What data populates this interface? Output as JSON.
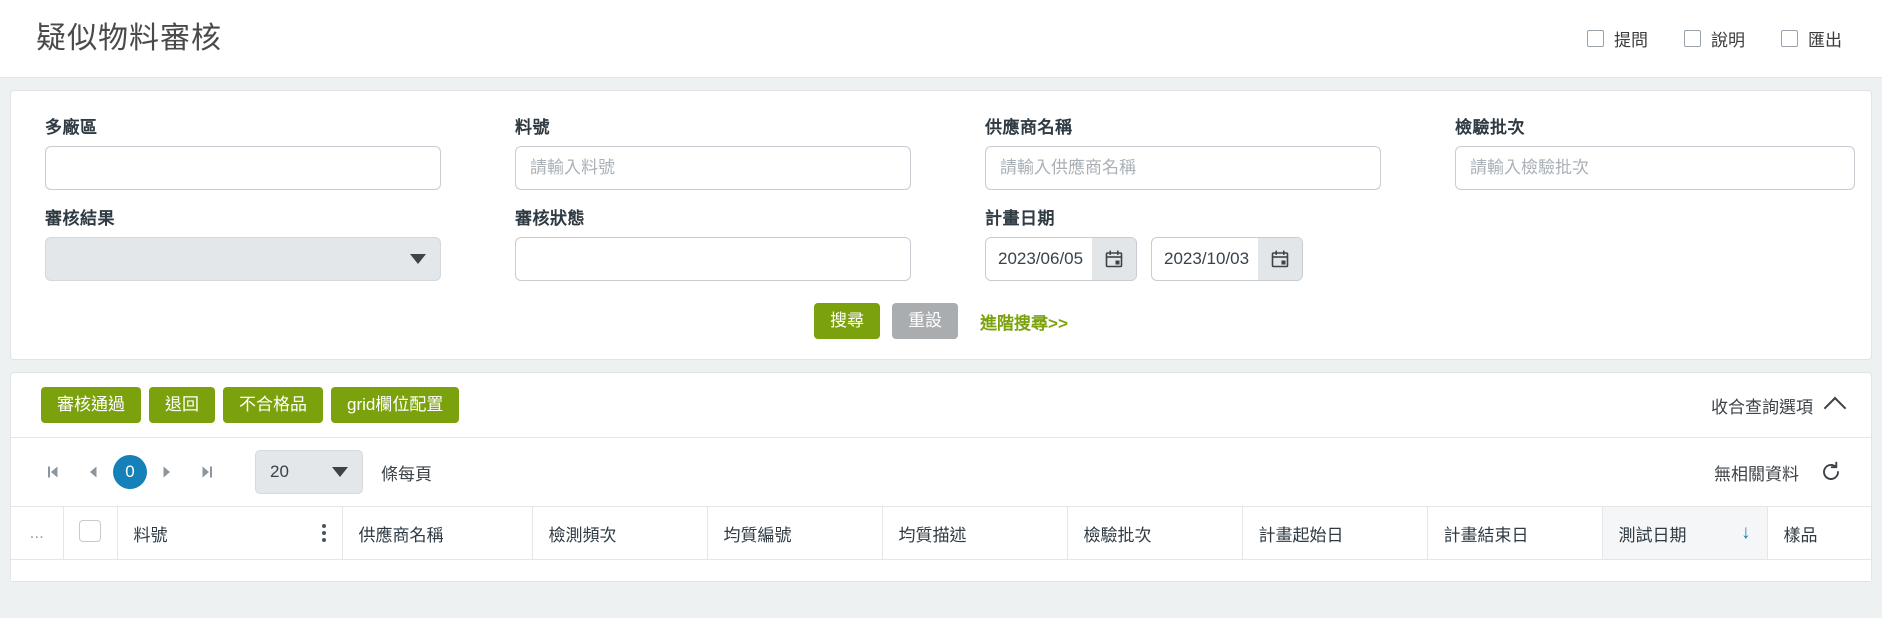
{
  "header": {
    "title": "疑似物料審核",
    "actions": [
      {
        "label": "提問",
        "icon": "checkbox-icon"
      },
      {
        "label": "說明",
        "icon": "checkbox-icon"
      },
      {
        "label": "匯出",
        "icon": "checkbox-icon"
      }
    ]
  },
  "search": {
    "fields": {
      "plant": {
        "label": "多廠區",
        "value": "",
        "placeholder": ""
      },
      "material_no": {
        "label": "料號",
        "value": "",
        "placeholder": "請輸入料號"
      },
      "supplier_name": {
        "label": "供應商名稱",
        "value": "",
        "placeholder": "請輸入供應商名稱"
      },
      "inspection_lot": {
        "label": "檢驗批次",
        "value": "",
        "placeholder": "請輸入檢驗批次"
      },
      "review_result": {
        "label": "審核結果",
        "value": "",
        "placeholder": ""
      },
      "review_status": {
        "label": "審核狀態",
        "value": "",
        "placeholder": ""
      },
      "plan_date": {
        "label": "計畫日期",
        "start": "2023/06/05",
        "end": "2023/10/03",
        "icon": "calendar-icon"
      }
    },
    "buttons": {
      "search": "搜尋",
      "reset": "重設",
      "advanced": "進階搜尋>>"
    }
  },
  "grid": {
    "toolbar": {
      "buttons": [
        "審核通過",
        "退回",
        "不合格品",
        "grid欄位配置"
      ],
      "collapse_label": "收合查詢選項",
      "collapse_icon": "chevron-up-icon"
    },
    "pager": {
      "first_icon": "first-page-icon",
      "prev_icon": "prev-page-icon",
      "current_page": "0",
      "next_icon": "next-page-icon",
      "last_icon": "last-page-icon",
      "page_size": "20",
      "per_page_label": "條每頁",
      "status": "無相關資料",
      "refresh_icon": "refresh-icon"
    },
    "columns": [
      {
        "label": "...",
        "type": "ellipsis"
      },
      {
        "label": "",
        "type": "checkbox"
      },
      {
        "label": "料號",
        "type": "text",
        "menu": true
      },
      {
        "label": "供應商名稱",
        "type": "text"
      },
      {
        "label": "檢測頻次",
        "type": "text"
      },
      {
        "label": "均質編號",
        "type": "text"
      },
      {
        "label": "均質描述",
        "type": "text"
      },
      {
        "label": "檢驗批次",
        "type": "text"
      },
      {
        "label": "計畫起始日",
        "type": "text"
      },
      {
        "label": "計畫結束日",
        "type": "text"
      },
      {
        "label": "測試日期",
        "type": "text",
        "sorted": "desc"
      },
      {
        "label": "樣品",
        "type": "text"
      }
    ],
    "rows": []
  },
  "colors": {
    "accent_green": "#7ba20c",
    "accent_blue": "#1681b8",
    "gray_button": "#aaadb0"
  }
}
